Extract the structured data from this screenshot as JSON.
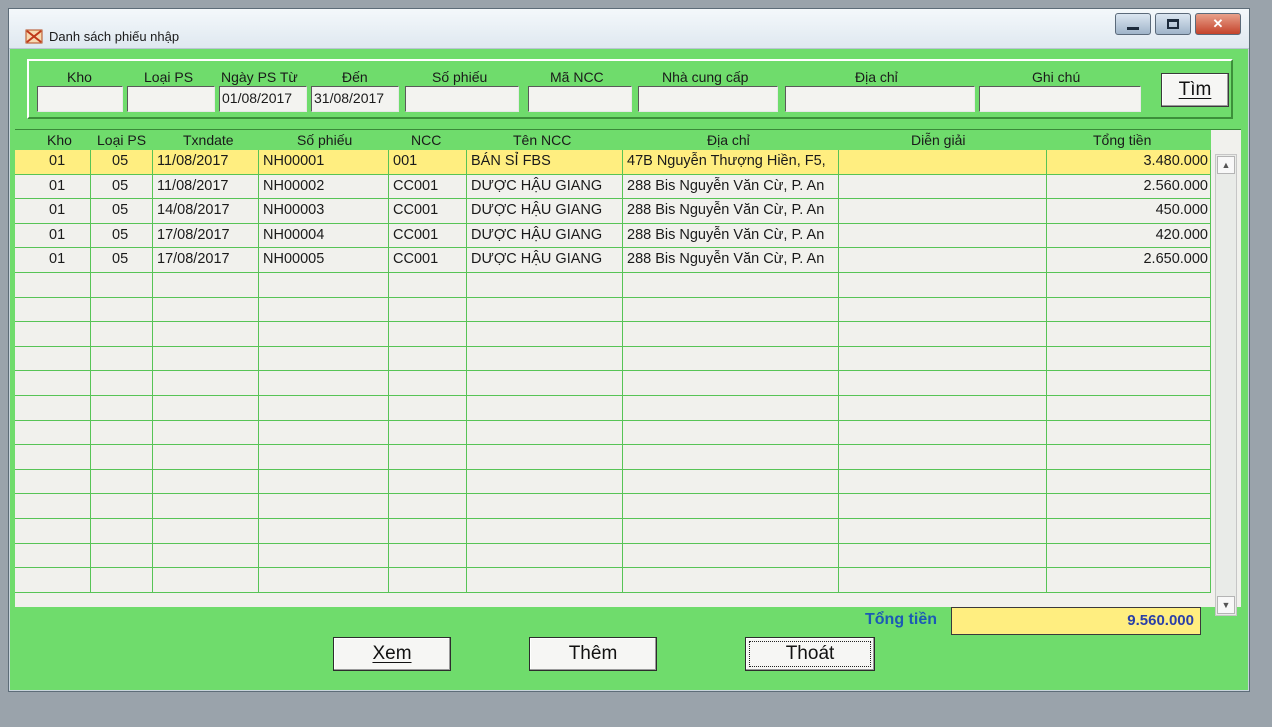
{
  "window": {
    "title": "Danh sách phiếu nhập"
  },
  "filters": {
    "labels": [
      "Kho",
      "Loại PS",
      "Ngày PS Từ",
      "Đến",
      "Số phiếu",
      "Mã NCC",
      "Nhà cung cấp",
      "Địa chỉ",
      "Ghi chú"
    ],
    "values": [
      "",
      "",
      "01/08/2017",
      "31/08/2017",
      "",
      "",
      "",
      "",
      ""
    ],
    "find_label": "Tìm"
  },
  "grid": {
    "headers": [
      "Kho",
      "Loại PS",
      "Txndate",
      "Số phiếu",
      "NCC",
      "Tên NCC",
      "Địa chỉ",
      "Diễn giải",
      "Tổng tiền"
    ],
    "rows": [
      [
        "01",
        "05",
        "11/08/2017",
        "NH00001",
        "001",
        "BÁN SỈ FBS",
        "47B Nguyễn Thượng Hiền, F5,",
        "",
        "3.480.000"
      ],
      [
        "01",
        "05",
        "11/08/2017",
        "NH00002",
        "CC001",
        "DƯỢC HẬU GIANG",
        "288 Bis Nguyễn Văn Cừ, P. An",
        "",
        "2.560.000"
      ],
      [
        "01",
        "05",
        "14/08/2017",
        "NH00003",
        "CC001",
        "DƯỢC HẬU GIANG",
        "288 Bis Nguyễn Văn Cừ, P. An",
        "",
        "450.000"
      ],
      [
        "01",
        "05",
        "17/08/2017",
        "NH00004",
        "CC001",
        "DƯỢC HẬU GIANG",
        "288 Bis Nguyễn Văn Cừ, P. An",
        "",
        "420.000"
      ],
      [
        "01",
        "05",
        "17/08/2017",
        "NH00005",
        "CC001",
        "DƯỢC HẬU GIANG",
        "288 Bis Nguyễn Văn Cừ, P. An",
        "",
        "2.650.000"
      ]
    ],
    "selected_row": 0
  },
  "total": {
    "label": "Tổng tiền",
    "value": "9.560.000"
  },
  "actions": {
    "view": "Xem",
    "add": "Thêm",
    "exit": "Thoát"
  },
  "colors": {
    "window_bg": "#6fdc6c",
    "selected_row": "#ffee80",
    "total_label": "#1b5ab5"
  }
}
